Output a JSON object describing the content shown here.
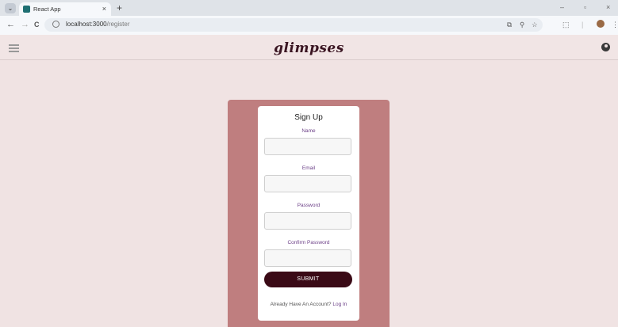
{
  "browser": {
    "tab_title": "React App",
    "tab_close": "×",
    "new_tab": "+",
    "url_host": "localhost:3000",
    "url_path": "/register",
    "nav": {
      "back": "←",
      "forward": "→",
      "reload": "C"
    },
    "window": {
      "minimize": "–",
      "restore": "▫",
      "close": "×"
    },
    "icons": [
      "cast-icon",
      "zoom-icon",
      "bookmark-star-icon",
      "extensions-icon",
      "profile-avatar",
      "menu-kebab-icon"
    ]
  },
  "app": {
    "brand": "glimpses"
  },
  "form": {
    "title": "Sign Up",
    "fields": [
      {
        "label": "Name",
        "value": ""
      },
      {
        "label": "Email",
        "value": ""
      },
      {
        "label": "Password",
        "value": ""
      },
      {
        "label": "Confirm Password",
        "value": ""
      }
    ],
    "submit_label": "SUBMIT",
    "login_prompt": "Already Have An Account?",
    "login_link": "Log In"
  },
  "colors": {
    "page_bg": "#f0e3e3",
    "outer_card": "#bf7e7f",
    "submit_bg": "#3a0a16",
    "accent_text": "#6b3f87"
  }
}
